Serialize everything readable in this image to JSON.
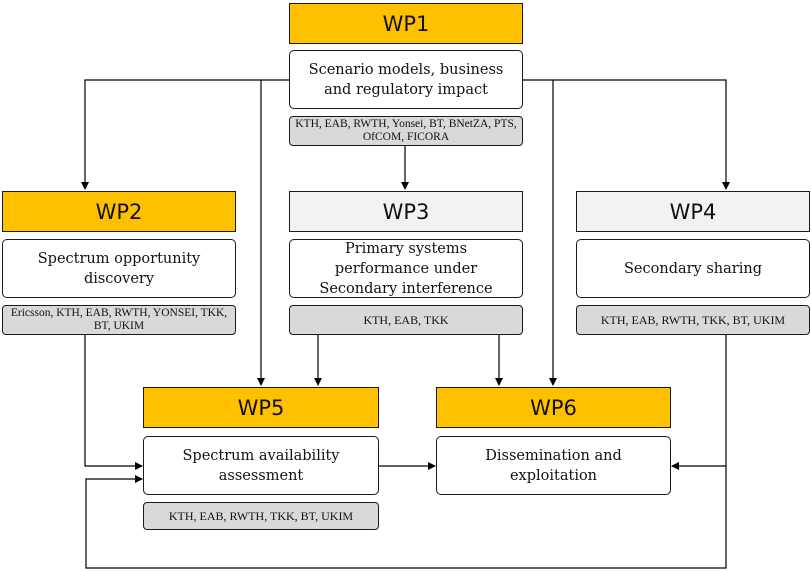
{
  "workpackages": [
    {
      "id": "WP1",
      "label": "WP1",
      "style": "accent",
      "description": "Scenario models, business and regulatory impact",
      "partners": "KTH, EAB, RWTH, Yonsei, BT, BNetZA, PTS, OfCOM, FICORA"
    },
    {
      "id": "WP2",
      "label": "WP2",
      "style": "accent",
      "description": "Spectrum opportunity discovery",
      "partners": "Ericsson, KTH, EAB, RWTH, YONSEI, TKK, BT, UKIM"
    },
    {
      "id": "WP3",
      "label": "WP3",
      "style": "plain",
      "description": "Primary systems performance under Secondary interference",
      "partners": "KTH, EAB, TKK"
    },
    {
      "id": "WP4",
      "label": "WP4",
      "style": "plain",
      "description": "Secondary sharing",
      "partners": "KTH, EAB, RWTH, TKK, BT, UKIM"
    },
    {
      "id": "WP5",
      "label": "WP5",
      "style": "accent",
      "description": "Spectrum availability assessment",
      "partners": "KTH, EAB, RWTH, TKK, BT, UKIM"
    },
    {
      "id": "WP6",
      "label": "WP6",
      "style": "accent",
      "description": "Dissemination and exploitation",
      "partners": null
    }
  ],
  "connections": [
    {
      "from": "WP1",
      "to": "WP2"
    },
    {
      "from": "WP1",
      "to": "WP3"
    },
    {
      "from": "WP1",
      "to": "WP4"
    },
    {
      "from": "WP1",
      "to": "WP5"
    },
    {
      "from": "WP1",
      "to": "WP6"
    },
    {
      "from": "WP2",
      "to": "WP5"
    },
    {
      "from": "WP3",
      "to": "WP5"
    },
    {
      "from": "WP3",
      "to": "WP6"
    },
    {
      "from": "WP4",
      "to": "WP6"
    },
    {
      "from": "WP4",
      "to": "WP5"
    },
    {
      "from": "WP5",
      "to": "WP6"
    }
  ],
  "colors": {
    "accent": "#FFC000",
    "plain_header": "#F2F2F2",
    "partner_fill": "#D9D9D9",
    "line": "#000000"
  }
}
